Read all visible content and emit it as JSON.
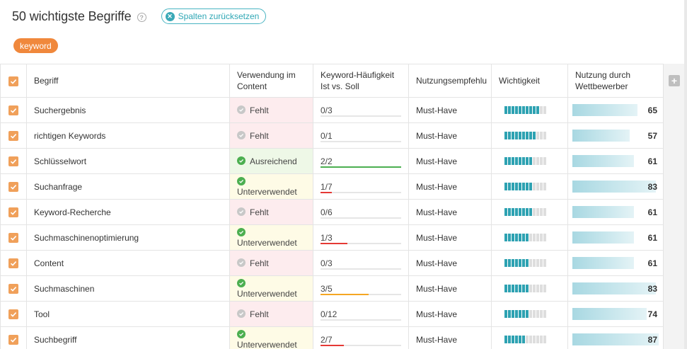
{
  "header": {
    "title": "50 wichtigste Begriffe",
    "help_icon": "?",
    "reset_label": "Spalten zurücksetzen"
  },
  "tag": {
    "label": "keyword"
  },
  "columns": {
    "term": "Begriff",
    "usage_line1": "Verwendung im",
    "usage_line2": "Content",
    "freq_line1": "Keyword-Häufigkeit",
    "freq_line2": "Ist vs. Soll",
    "recommendation": "Nutzungsempfehlu",
    "importance": "Wichtigkeit",
    "competition_line1": "Nutzung durch",
    "competition_line2": "Wettbewerber"
  },
  "status_colors": {
    "missing": "#fdecee",
    "sufficient": "#eef8e7",
    "underused": "#fefbe6",
    "accent": "#2ea2b2",
    "tag": "#f0883c"
  },
  "rows": [
    {
      "term": "Suchergebnis",
      "usage": "Fehlt",
      "usage_status": "missing",
      "freq": "0/3",
      "freq_fraction": 0,
      "freq_color": "#e53935",
      "recommendation": "Must-Have",
      "importance": 10,
      "competition": "65",
      "competition_fraction": 0.75
    },
    {
      "term": "richtigen Keywords",
      "usage": "Fehlt",
      "usage_status": "missing",
      "freq": "0/1",
      "freq_fraction": 0,
      "freq_color": "#e53935",
      "recommendation": "Must-Have",
      "importance": 9,
      "competition": "57",
      "competition_fraction": 0.66
    },
    {
      "term": "Schlüsselwort",
      "usage": "Ausreichend",
      "usage_status": "sufficient",
      "freq": "2/2",
      "freq_fraction": 1,
      "freq_color": "#4caf50",
      "recommendation": "Must-Have",
      "importance": 8,
      "competition": "61",
      "competition_fraction": 0.71
    },
    {
      "term": "Suchanfrage",
      "usage": "Unterverwendet",
      "usage_status": "underused",
      "freq": "1/7",
      "freq_fraction": 0.14,
      "freq_color": "#e53935",
      "recommendation": "Must-Have",
      "importance": 8,
      "competition": "83",
      "competition_fraction": 0.97
    },
    {
      "term": "Keyword-Recherche",
      "usage": "Fehlt",
      "usage_status": "missing",
      "freq": "0/6",
      "freq_fraction": 0,
      "freq_color": "#e53935",
      "recommendation": "Must-Have",
      "importance": 8,
      "competition": "61",
      "competition_fraction": 0.71
    },
    {
      "term": "Suchmaschinenoptimierung",
      "usage": "Unterverwendet",
      "usage_status": "underused",
      "freq": "1/3",
      "freq_fraction": 0.33,
      "freq_color": "#e53935",
      "recommendation": "Must-Have",
      "importance": 7,
      "competition": "61",
      "competition_fraction": 0.71
    },
    {
      "term": "Content",
      "usage": "Fehlt",
      "usage_status": "missing",
      "freq": "0/3",
      "freq_fraction": 0,
      "freq_color": "#e53935",
      "recommendation": "Must-Have",
      "importance": 7,
      "competition": "61",
      "competition_fraction": 0.71
    },
    {
      "term": "Suchmaschinen",
      "usage": "Unterverwendet",
      "usage_status": "underused",
      "freq": "3/5",
      "freq_fraction": 0.6,
      "freq_color": "#f5a623",
      "recommendation": "Must-Have",
      "importance": 7,
      "competition": "83",
      "competition_fraction": 0.97
    },
    {
      "term": "Tool",
      "usage": "Fehlt",
      "usage_status": "missing",
      "freq": "0/12",
      "freq_fraction": 0,
      "freq_color": "#e53935",
      "recommendation": "Must-Have",
      "importance": 7,
      "competition": "74",
      "competition_fraction": 0.86
    },
    {
      "term": "Suchbegriff",
      "usage": "Unterverwendet",
      "usage_status": "underused",
      "freq": "2/7",
      "freq_fraction": 0.29,
      "freq_color": "#e53935",
      "recommendation": "Must-Have",
      "importance": 6,
      "competition": "87",
      "competition_fraction": 1.0
    }
  ]
}
